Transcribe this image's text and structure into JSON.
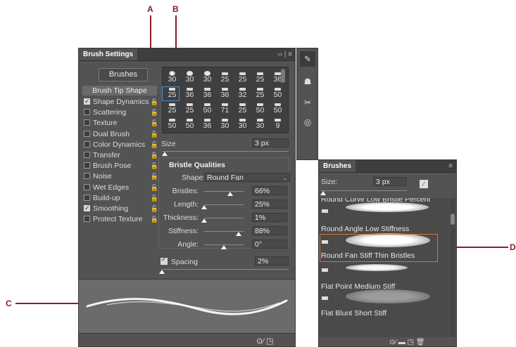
{
  "callouts": {
    "a": "A",
    "b": "B",
    "c": "C",
    "d": "D"
  },
  "panel": {
    "title": "Brush Settings",
    "menu_glyphs": "›› | ≡",
    "brushes_button": "Brushes",
    "tip_shape": "Brush Tip Shape",
    "options": [
      {
        "label": "Shape Dynamics",
        "checked": true
      },
      {
        "label": "Scattering",
        "checked": false
      },
      {
        "label": "Texture",
        "checked": false
      },
      {
        "label": "Dual Brush",
        "checked": false
      },
      {
        "label": "Color Dynamics",
        "checked": false
      },
      {
        "label": "Transfer",
        "checked": false
      },
      {
        "label": "Brush Pose",
        "checked": false
      },
      {
        "label": "Noise",
        "checked": false
      },
      {
        "label": "Wet Edges",
        "checked": false
      },
      {
        "label": "Build-up",
        "checked": false
      },
      {
        "label": "Smoothing",
        "checked": true
      },
      {
        "label": "Protect Texture",
        "checked": false
      }
    ],
    "preset_sizes": [
      "30",
      "30",
      "30",
      "25",
      "25",
      "25",
      "36",
      "25",
      "36",
      "36",
      "36",
      "32",
      "25",
      "50",
      "25",
      "25",
      "50",
      "71",
      "25",
      "50",
      "50",
      "50",
      "50",
      "36",
      "30",
      "30",
      "30",
      "9"
    ],
    "size_label": "Size",
    "size_value": "3 px",
    "size_level": 0.02,
    "bristle_title": "Bristle Qualities",
    "shape_label": "Shape:",
    "shape_value": "Round Fan",
    "qualities": [
      {
        "label": "Bristles:",
        "value": "66%",
        "level": 0.66
      },
      {
        "label": "Length:",
        "value": "25%",
        "level": 0.0
      },
      {
        "label": "Thickness:",
        "value": "1%",
        "level": 0.0
      },
      {
        "label": "Stiffness:",
        "value": "88%",
        "level": 0.88
      },
      {
        "label": "Angle:",
        "value": "0°",
        "level": 0.5
      }
    ],
    "spacing_label": "Spacing",
    "spacing_value": "2%",
    "spacing_level": 0.0,
    "footer_icons": "⊙⁄   ◳"
  },
  "toolbar": {
    "icons": [
      "brush-panel-icon",
      "clone-source-icon",
      "tool-presets-icon",
      "libraries-icon"
    ]
  },
  "brushes_panel": {
    "title": "Brushes",
    "menu": "≡",
    "size_label": "Size:",
    "size_value": "3 px",
    "items": [
      "Round Curve Low Bristle Percent",
      "Round Angle Low Stiffness",
      "Round Fan Stiff Thin Bristles",
      "Flat Point Medium Stiff",
      "Flat Blunt Short Stiff"
    ],
    "footer_icons": "⊙⁄  ▬  ◳  🗑"
  }
}
